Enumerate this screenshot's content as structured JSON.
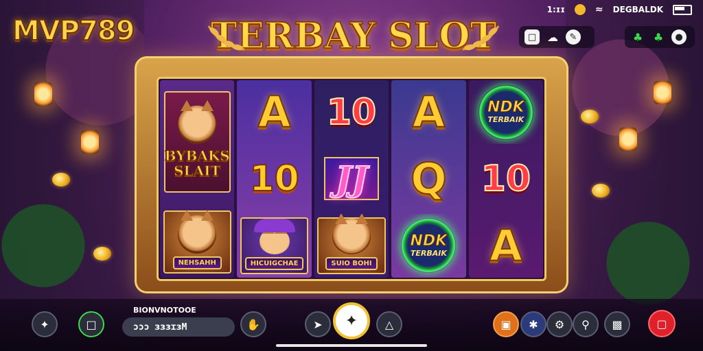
{
  "app": {
    "logo": "MVP789",
    "title": "TERBAY SLOT"
  },
  "status_bar": {
    "time": "1:ɪɪ",
    "network": "DEGBALDK"
  },
  "top_right": {
    "panel_left": [
      {
        "icon": "window-icon"
      },
      {
        "icon": "cloud-icon"
      },
      {
        "icon": "settings-icon"
      }
    ],
    "panel_right": [
      {
        "icon": "clover-icon"
      },
      {
        "icon": "clover-icon-2"
      },
      {
        "icon": "help-icon"
      }
    ]
  },
  "reels": [
    [
      {
        "type": "title",
        "lines": [
          "BYBAKS",
          "SLAIT"
        ]
      },
      {
        "type": "wild",
        "label": "NEHSAHH"
      }
    ],
    [
      {
        "type": "letter",
        "text": "A"
      },
      {
        "type": "number",
        "text": "10",
        "color": "gold"
      },
      {
        "type": "wild-hat",
        "label": "HICUIGCHAE"
      }
    ],
    [
      {
        "type": "number",
        "text": "10",
        "color": "red"
      },
      {
        "type": "jj",
        "text": "JJ"
      },
      {
        "type": "wild",
        "label": "SUIO BOHI"
      }
    ],
    [
      {
        "type": "letter",
        "text": "A"
      },
      {
        "type": "letter",
        "text": "Q"
      },
      {
        "type": "ndk",
        "line1": "NDK",
        "line2": "TERBAIK"
      }
    ],
    [
      {
        "type": "ndk",
        "line1": "NDK",
        "line2": "TERBAIK"
      },
      {
        "type": "number",
        "text": "10",
        "color": "red"
      },
      {
        "type": "letter",
        "text": "A"
      }
    ]
  ],
  "bottom_bar": {
    "balance_label": "BIONVNOTOOE",
    "balance_value": "ɔɔɔ ɜɜɜɪɜM",
    "left_buttons": [
      "menu-sparkle-icon",
      "lobby-icon"
    ],
    "mid_buttons": [
      "hand-icon",
      "arrow-icon",
      "turbo-icon"
    ],
    "spin_icon": "spin-icon",
    "right_buttons": [
      "gift-icon",
      "puzzle-icon",
      "gear-icon",
      "search-icon",
      "chat-icon",
      "exit-icon"
    ],
    "colors": {
      "spin_ring": "#f2c233",
      "exit": "#e0202a",
      "gift": "#e0701a"
    }
  }
}
